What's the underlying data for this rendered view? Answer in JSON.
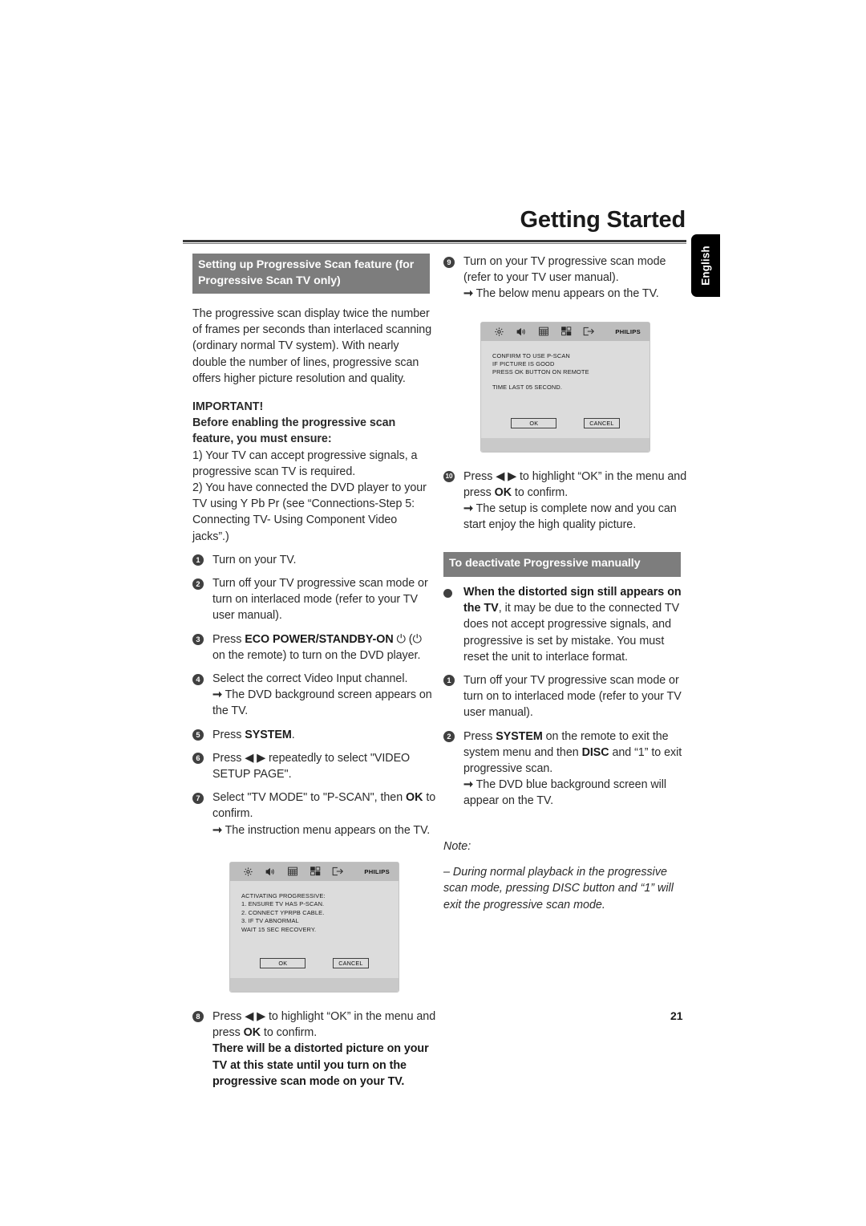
{
  "document": {
    "page_title": "Getting Started",
    "language_tab": "English",
    "page_number": "21"
  },
  "colors": {
    "band_gray": "#7d7d7d",
    "tab_black": "#000000",
    "text": "#2b2b2b"
  },
  "left_column": {
    "section_band": "Setting up Progressive Scan feature (for Progressive Scan TV only)",
    "intro": "The progressive scan display twice the number of frames per seconds than interlaced scanning (ordinary normal TV system). With nearly double the number of lines, progressive scan offers higher picture resolution and quality.",
    "important_label": "IMPORTANT!",
    "important_sub": "Before enabling the progressive scan feature, you must ensure:",
    "ensure_1": "1) Your TV can accept progressive signals, a progressive scan TV is required.",
    "ensure_2": "2) You have connected the DVD player to your TV using Y Pb Pr (see “Connections-Step 5: Connecting TV- Using Component Video jacks”.)",
    "steps": [
      {
        "num": "1",
        "text": "Turn on your TV."
      },
      {
        "num": "2",
        "text": "Turn off your TV progressive scan mode or turn on interlaced mode (refer to your TV user manual)."
      },
      {
        "num": "3",
        "pre": "Press ",
        "bold": "ECO POWER/STANDBY-ON",
        "post": " ⏻ (⏻ on the remote) to turn on the DVD player."
      },
      {
        "num": "4",
        "text": "Select the correct Video Input channel.",
        "arrow": "The DVD background screen appears on the TV."
      },
      {
        "num": "5",
        "pre": "Press ",
        "bold": "SYSTEM",
        "post": "."
      },
      {
        "num": "6",
        "text": "Press ◀ ▶ repeatedly to select \"VIDEO SETUP PAGE\"."
      },
      {
        "num": "7",
        "pre": "Select \"TV MODE\" to \"P-SCAN\", then ",
        "bold": "OK",
        "post": " to confirm.",
        "arrow": "The instruction menu appears on the TV."
      }
    ],
    "step8": {
      "num": "8",
      "pre": "Press ◀ ▶ to highlight “OK” in the menu and press ",
      "bold": "OK",
      "post": " to confirm.",
      "warning": "There will be a distorted picture on your TV at this state until you turn on the progressive scan mode on your TV."
    },
    "tv_menu": {
      "brand": "PHILIPS",
      "icons": [
        "gear-icon",
        "speaker-icon",
        "grid-icon",
        "squares-icon",
        "exit-icon"
      ],
      "lines": [
        "ACTIVATING PROGRESSIVE:",
        "1. ENSURE TV HAS P-SCAN.",
        "2. CONNECT YPRPB CABLE.",
        "3. IF TV ABNORMAL",
        "WAIT 15 SEC RECOVERY."
      ],
      "ok_label": "OK",
      "cancel_label": "CANCEL"
    }
  },
  "right_column": {
    "step9": {
      "num": "9",
      "text": "Turn on your TV progressive scan mode (refer to your TV user manual).",
      "arrow": "The below menu appears on the TV."
    },
    "tv_menu": {
      "brand": "PHILIPS",
      "icons": [
        "gear-icon",
        "speaker-icon",
        "grid-icon",
        "squares-icon",
        "exit-icon"
      ],
      "lines": [
        "CONFIRM TO USE P-SCAN",
        "IF PICTURE IS GOOD",
        "PRESS OK BUTTON ON REMOTE"
      ],
      "lines2": [
        "TIME LAST 05 SECOND."
      ],
      "ok_label": "OK",
      "cancel_label": "CANCEL"
    },
    "step10": {
      "num": "10",
      "pre": "Press ◀ ▶ to highlight “OK” in the menu and press ",
      "bold": "OK",
      "post": " to confirm.",
      "arrow": "The setup is complete now and you can start enjoy the high quality picture."
    },
    "section_band": "To deactivate Progressive manually",
    "bullet": {
      "bold": "When the distorted sign still appears on the TV",
      "rest": ", it may be due to the connected TV does not accept progressive signals, and progressive is set by mistake. You must reset the unit to interlace format."
    },
    "steps": [
      {
        "num": "1",
        "text": "Turn off your TV progressive scan mode or turn on to interlaced mode (refer to your TV user manual)."
      }
    ],
    "step2": {
      "num": "2",
      "pre": "Press ",
      "bold1": "SYSTEM",
      "mid": " on the remote to exit the system menu and then ",
      "bold2": "DISC",
      "post": " and “1” to exit progressive scan.",
      "arrow": "The DVD blue background screen will appear on the TV."
    },
    "note_label": "Note:",
    "note_text": "–   During normal playback in the progressive scan mode, pressing DISC button and “1” will exit the progressive scan mode."
  }
}
